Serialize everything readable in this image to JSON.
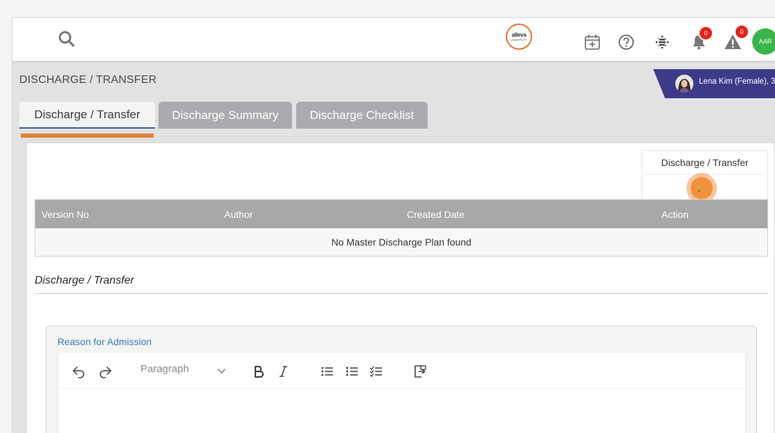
{
  "topbar": {
    "logo": {
      "brand": "alleva",
      "sub": "UNIVERSITY"
    },
    "notification_count": "0",
    "alert_count": "0",
    "user_initials": "AAR"
  },
  "page": {
    "title": "DISCHARGE / TRANSFER",
    "patient": "Lena Kim (Female), 3"
  },
  "tabs": [
    {
      "label": "Discharge / Transfer",
      "active": true
    },
    {
      "label": "Discharge Summary",
      "active": false
    },
    {
      "label": "Discharge Checklist",
      "active": false
    }
  ],
  "action_card": {
    "title": "Discharge / Transfer"
  },
  "table": {
    "columns": [
      "Version No",
      "Author",
      "Created Date",
      "Action"
    ],
    "empty_message": "No Master Discharge Plan found"
  },
  "section": {
    "title": "Discharge / Transfer"
  },
  "field": {
    "label": "Reason for Admission",
    "editor": {
      "block_format": "Paragraph"
    }
  },
  "colors": {
    "accent_orange": "#f2913d",
    "patient_banner": "#3e3a8a",
    "badge_red": "#e3261c",
    "avatar_green": "#3bb54a",
    "label_blue": "#3a7bbf"
  }
}
